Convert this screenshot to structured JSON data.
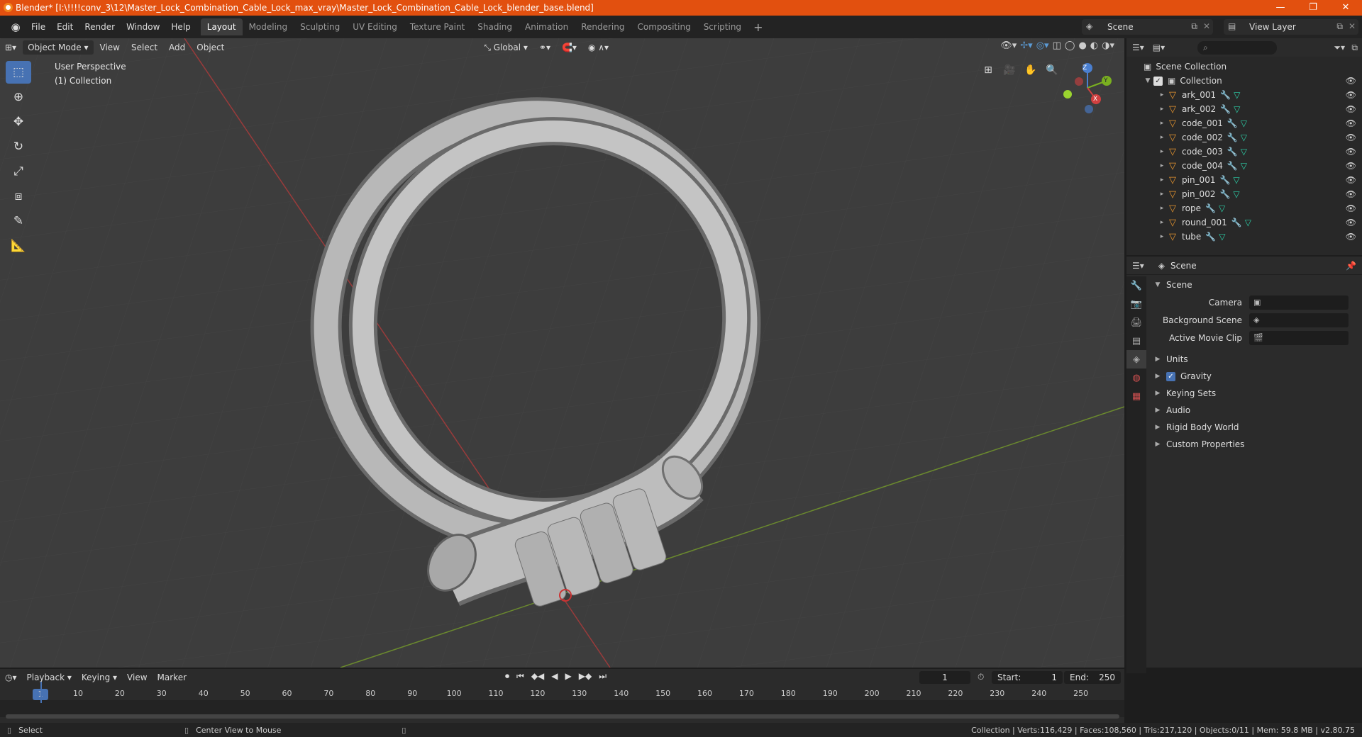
{
  "window": {
    "title": "Blender* [I:\\!!!!conv_3\\12\\Master_Lock_Combination_Cable_Lock_max_vray\\Master_Lock_Combination_Cable_Lock_blender_base.blend]",
    "minimize": "—",
    "maximize": "❐",
    "close": "✕"
  },
  "menu": [
    "File",
    "Edit",
    "Render",
    "Window",
    "Help"
  ],
  "workspaces": [
    "Layout",
    "Modeling",
    "Sculpting",
    "UV Editing",
    "Texture Paint",
    "Shading",
    "Animation",
    "Rendering",
    "Compositing",
    "Scripting"
  ],
  "active_workspace": "Layout",
  "scene_name": "Scene",
  "view_layer": "View Layer",
  "viewport": {
    "mode": "Object Mode",
    "menus": [
      "View",
      "Select",
      "Add",
      "Object"
    ],
    "transform_orientation": "Global",
    "overlay_title": "User Perspective",
    "overlay_collection": "(1) Collection",
    "gizmo_axes": [
      "X",
      "Y",
      "Z"
    ]
  },
  "outliner": {
    "root": "Scene Collection",
    "collection": "Collection",
    "objects": [
      "ark_001",
      "ark_002",
      "code_001",
      "code_002",
      "code_003",
      "code_004",
      "pin_001",
      "pin_002",
      "rope",
      "round_001",
      "tube"
    ]
  },
  "properties": {
    "header": "Scene",
    "section": "Scene",
    "fields": [
      {
        "label": "Camera",
        "value": ""
      },
      {
        "label": "Background Scene",
        "value": ""
      },
      {
        "label": "Active Movie Clip",
        "value": ""
      }
    ],
    "panels": [
      "Units",
      "Gravity",
      "Keying Sets",
      "Audio",
      "Rigid Body World",
      "Custom Properties"
    ],
    "gravity_checked": true
  },
  "timeline": {
    "menus": [
      "Playback",
      "Keying",
      "View",
      "Marker"
    ],
    "current_frame": "1",
    "start_label": "Start:",
    "start": "1",
    "end_label": "End:",
    "end": "250",
    "ticks": [
      "10",
      "20",
      "30",
      "40",
      "50",
      "60",
      "70",
      "80",
      "90",
      "100",
      "110",
      "120",
      "130",
      "140",
      "150",
      "160",
      "170",
      "180",
      "190",
      "200",
      "210",
      "220",
      "230",
      "240",
      "250"
    ]
  },
  "statusbar": {
    "left": "Select",
    "middle": "Center View to Mouse",
    "right": "Collection | Verts:116,429 | Faces:108,560 | Tris:217,120 | Objects:0/11 | Mem: 59.8 MB | v2.80.75"
  }
}
